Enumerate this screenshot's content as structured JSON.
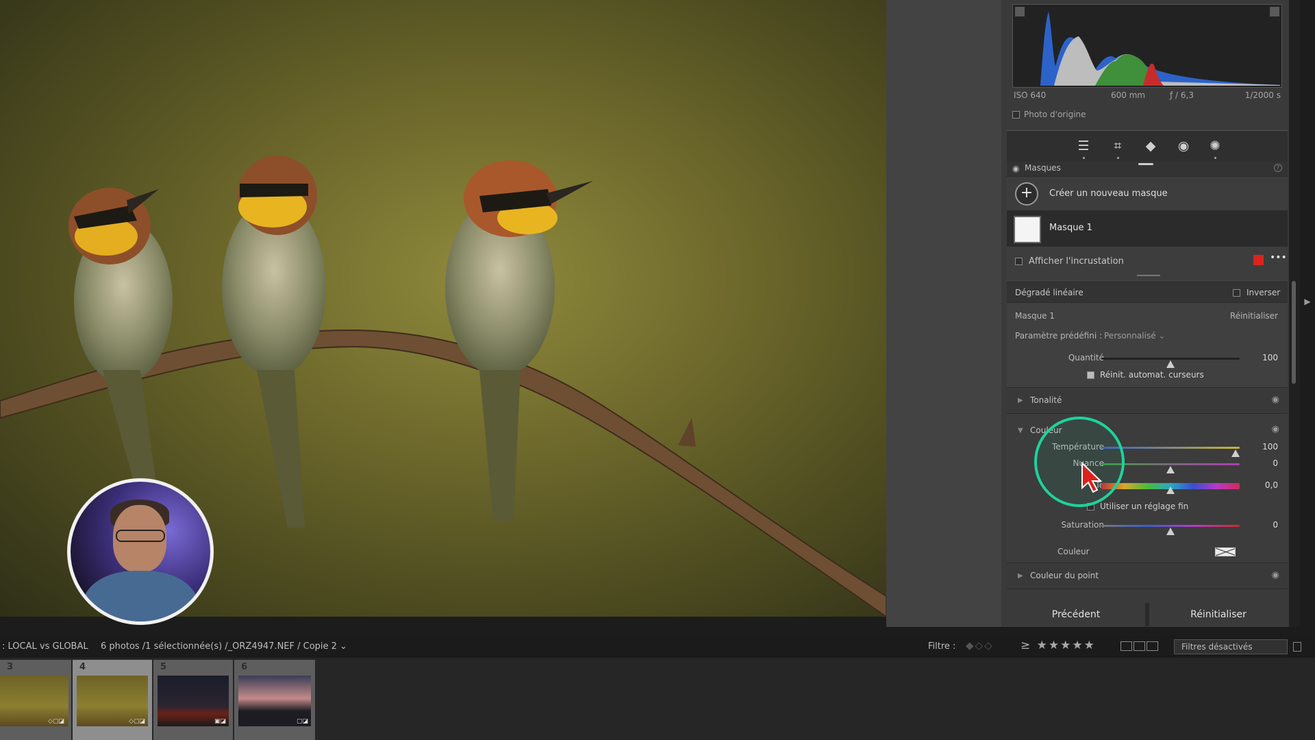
{
  "histogram": {
    "iso": "ISO 640",
    "focal": "600 mm",
    "aperture": "ƒ / 6,3",
    "shutter": "1/2000 s",
    "original_photo_label": "Photo d'origine"
  },
  "masks": {
    "header_label": "Masques",
    "create_label": "Créer un nouveau masque",
    "mask1_label": "Masque 1",
    "overlay_label": "Afficher l'incrustation",
    "overlay_color": "#d8261d",
    "linear_gradient_label": "Dégradé linéaire",
    "invert_label": "Inverser"
  },
  "mask_settings": {
    "mask_name": "Masque 1",
    "reset_label": "Réinitialiser",
    "preset_label": "Paramètre prédéfini :",
    "preset_value": "Personnalisé",
    "amount_label": "Quantité",
    "amount_value": "100",
    "amount_level": 0.5,
    "auto_reset_label": "Réinit. automat. curseurs"
  },
  "sections": {
    "tone_label": "Tonalité",
    "color_label": "Couleur",
    "point_color_label": "Couleur du point"
  },
  "color": {
    "temp_label": "Température",
    "temp_value": "100",
    "temp_level": 0.97,
    "tint_label": "Nuance",
    "tint_value": "0",
    "tint_level": 0.5,
    "hue_label": "Te",
    "hue_value": "0,0",
    "hue_level": 0.5,
    "fine_label": "Utiliser un réglage fin",
    "sat_label": "Saturation",
    "sat_value": "0",
    "sat_level": 0.5,
    "color_label": "Couleur"
  },
  "buttons": {
    "previous": "Précédent",
    "reset": "Réinitialiser"
  },
  "filmstrip_bar": {
    "source": ": LOCAL vs GLOBAL",
    "info": "6 photos /1 sélectionnée(s) /_ORZ4947.NEF / Copie 2 ⌄",
    "filter_label": "Filtre :",
    "rating_prefix": "≥",
    "stars": "★★★★★",
    "filters_off": "Filtres désactivés"
  },
  "thumbnails": [
    {
      "num": "3"
    },
    {
      "num": "4"
    },
    {
      "num": "5"
    },
    {
      "num": "6"
    }
  ],
  "icons": [
    "eye-icon",
    "plus-icon",
    "sliders-icon",
    "crop-icon",
    "eraser-icon",
    "red-eye-icon",
    "mask-icon",
    "cursor-icon",
    "help-icon",
    "more-icon"
  ],
  "colors": {
    "highlight_ring": "#1fd29a",
    "cursor": "#e0201a"
  }
}
